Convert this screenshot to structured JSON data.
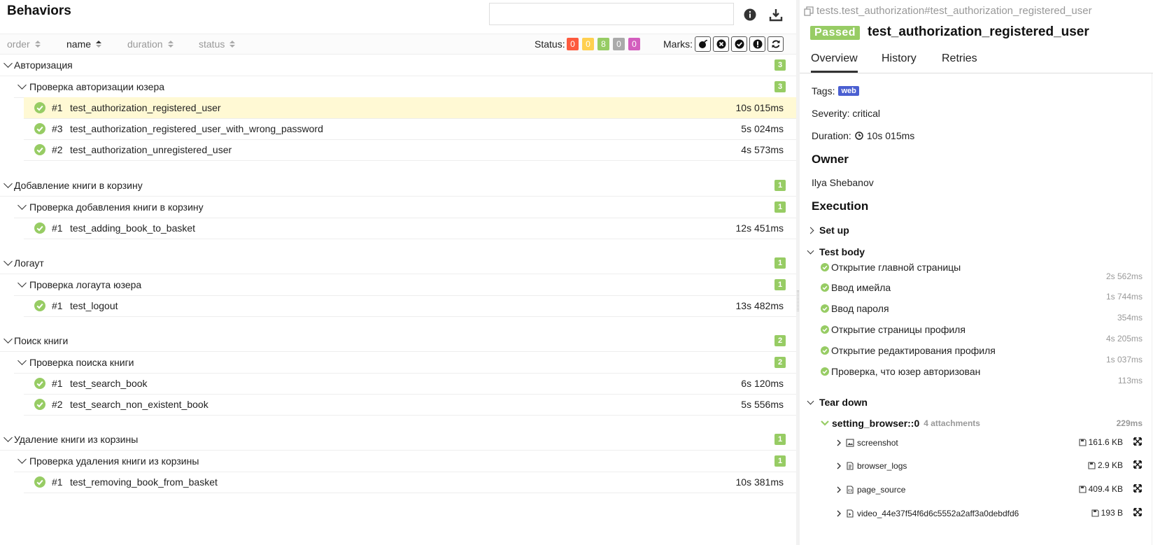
{
  "left": {
    "title": "Behaviors",
    "search": {
      "value": "",
      "placeholder": ""
    },
    "icons": [
      "info-icon",
      "download-icon"
    ],
    "sort": {
      "order": "order",
      "name": "name",
      "duration": "duration",
      "status": "status"
    },
    "status_label": "Status:",
    "status_counts": [
      {
        "value": "0",
        "color": "#fd5a3e"
      },
      {
        "value": "0",
        "color": "#ffd050"
      },
      {
        "value": "8",
        "color": "#97cc64"
      },
      {
        "value": "0",
        "color": "#aaaaaa"
      },
      {
        "value": "0",
        "color": "#d35ebe"
      }
    ],
    "marks_label": "Marks:",
    "groups": [
      {
        "name": "Авторизация",
        "count": "3",
        "sub": {
          "name": "Проверка авторизации юзера",
          "count": "3",
          "tests": [
            {
              "num": "#1",
              "name": "test_authorization_registered_user",
              "dur": "10s 015ms",
              "selected": true
            },
            {
              "num": "#3",
              "name": "test_authorization_registered_user_with_wrong_password",
              "dur": "5s 024ms"
            },
            {
              "num": "#2",
              "name": "test_authorization_unregistered_user",
              "dur": "4s 573ms"
            }
          ]
        }
      },
      {
        "name": "Добавление книги в корзину",
        "count": "1",
        "sub": {
          "name": "Проверка добавления книги в корзину",
          "count": "1",
          "tests": [
            {
              "num": "#1",
              "name": "test_adding_book_to_basket",
              "dur": "12s 451ms"
            }
          ]
        }
      },
      {
        "name": "Логаут",
        "count": "1",
        "sub": {
          "name": "Проверка логаута юзера",
          "count": "1",
          "tests": [
            {
              "num": "#1",
              "name": "test_logout",
              "dur": "13s 482ms"
            }
          ]
        }
      },
      {
        "name": "Поиск книги",
        "count": "2",
        "sub": {
          "name": "Проверка поиска книги",
          "count": "2",
          "tests": [
            {
              "num": "#1",
              "name": "test_search_book",
              "dur": "6s 120ms"
            },
            {
              "num": "#2",
              "name": "test_search_non_existent_book",
              "dur": "5s 556ms"
            }
          ]
        }
      },
      {
        "name": "Удаление книги из корзины",
        "count": "1",
        "sub": {
          "name": "Проверка удаления книги из корзины",
          "count": "1",
          "tests": [
            {
              "num": "#1",
              "name": "test_removing_book_from_basket",
              "dur": "10s 381ms"
            }
          ]
        }
      }
    ]
  },
  "right": {
    "uid": "tests.test_authorization#test_authorization_registered_user",
    "status": "Passed",
    "title": "test_authorization_registered_user",
    "tabs": [
      "Overview",
      "History",
      "Retries"
    ],
    "tags_label": "Tags:",
    "tag": "web",
    "severity": "Severity: critical",
    "duration_label": "Duration:",
    "duration": "10s 015ms",
    "owner_heading": "Owner",
    "owner": "Ilya Shebanov",
    "execution_heading": "Execution",
    "setup_label": "Set up",
    "testbody_label": "Test body",
    "steps": [
      {
        "name": "Открытие главной страницы",
        "dur": "2s 562ms"
      },
      {
        "name": "Ввод имейла",
        "dur": "1s 744ms"
      },
      {
        "name": "Ввод пароля",
        "dur": "354ms"
      },
      {
        "name": "Открытие страницы профиля",
        "dur": "4s 205ms"
      },
      {
        "name": "Открытие редактирования профиля",
        "dur": "1s 037ms"
      },
      {
        "name": "Проверка, что юзер авторизован",
        "dur": "113ms"
      }
    ],
    "teardown_label": "Tear down",
    "fixture": {
      "name": "setting_browser::0",
      "attachments": "4 attachments",
      "dur": "229ms"
    },
    "attachments": [
      {
        "name": "screenshot",
        "size": "161.6 KB",
        "icon": "image-icon"
      },
      {
        "name": "browser_logs",
        "size": "2.9 KB",
        "icon": "file-text-icon"
      },
      {
        "name": "page_source",
        "size": "409.4 KB",
        "icon": "file-code-icon"
      },
      {
        "name": "video_44e37f54f6d6c5552a2aff3a0debdfd6",
        "size": "193 B",
        "icon": "file-video-icon"
      }
    ],
    "colors": {
      "passed": "#97cc64",
      "tag": "#4a5fd1",
      "selected_row": "#fff9d4"
    }
  }
}
